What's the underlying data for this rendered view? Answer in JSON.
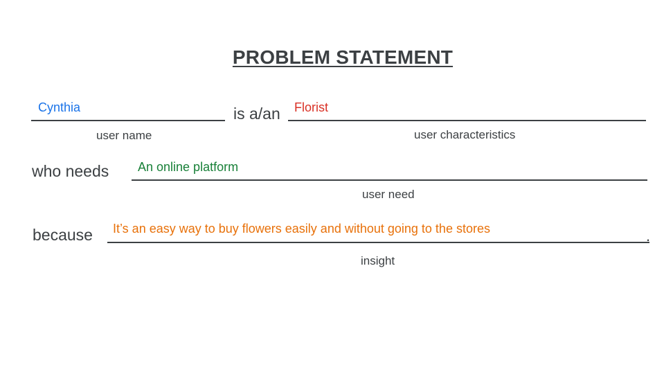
{
  "title": "PROBLEM STATEMENT",
  "row1": {
    "user_name_value": "Cynthia",
    "user_name_label": "user name",
    "connector": "is a/an",
    "characteristics_value": "Florist",
    "characteristics_label": "user characteristics"
  },
  "row2": {
    "connector": "who needs",
    "need_value": "An online platform",
    "need_label": "user need"
  },
  "row3": {
    "connector": "because",
    "insight_value": "It’s an easy way to buy flowers easily and without going to the stores",
    "insight_label": "insight",
    "end_punctuation": "."
  },
  "colors": {
    "user_name": "#1a73e8",
    "characteristics": "#d93025",
    "need": "#188038",
    "insight": "#e8710a",
    "text": "#3c4043"
  }
}
